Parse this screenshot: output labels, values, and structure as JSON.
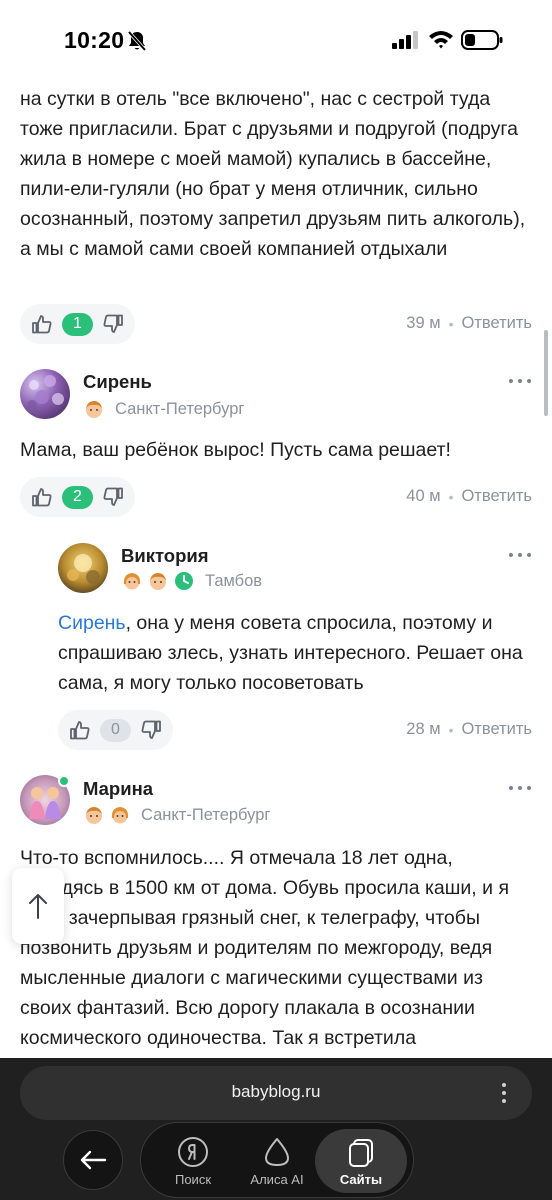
{
  "status_bar": {
    "time": "10:20"
  },
  "comments": [
    {
      "text": "на сутки в отель \"все включено\", нас с сестрой туда тоже пригласили. Брат с друзьями и подругой (подруга жила в номере с моей мамой) купались в бассейне, пили-ели-гуляли (но брат у меня отличник, сильно осознанный, поэтому запретил друзьям пить алкоголь), а мы с мамой сами своей компанией отдыхали",
      "votes": "1",
      "time": "39 м",
      "reply_label": "Ответить"
    },
    {
      "author": "Сирень",
      "city": "Санкт-Петербург",
      "text": "Мама, ваш ребёнок вырос! Пусть сама решает!",
      "votes": "2",
      "time": "40 м",
      "reply_label": "Ответить"
    },
    {
      "author": "Виктория",
      "city": "Тамбов",
      "mention": "Сирень",
      "text": ", она у меня совета спросила, поэтому и спрашиваю злесь, узнать интересного. Решает она сама, я могу только посоветовать",
      "votes": "0",
      "time": "28 м",
      "reply_label": "Ответить"
    },
    {
      "author": "Марина",
      "city": "Санкт-Петербург",
      "text": "Что-то вспомнилось.... Я отмечала 18 лет одна, находясь в 1500 км от дома. Обувь просила каши, и я шла, зачерпывая грязный снег, к телеграфу, чтобы позвонить друзьям и родителям по межгороду, ведя мысленные диалоги с магическими существами из своих фантазий. Всю дорогу плакала в осознании космического одиночества. Так я встретила"
    }
  ],
  "browser": {
    "url": "babyblog.ru",
    "nav": [
      {
        "label": "Поиск",
        "icon": "yandex-search-icon"
      },
      {
        "label": "Алиса AI",
        "icon": "alice-icon"
      },
      {
        "label": "Сайты",
        "icon": "sites-icon"
      }
    ]
  }
}
